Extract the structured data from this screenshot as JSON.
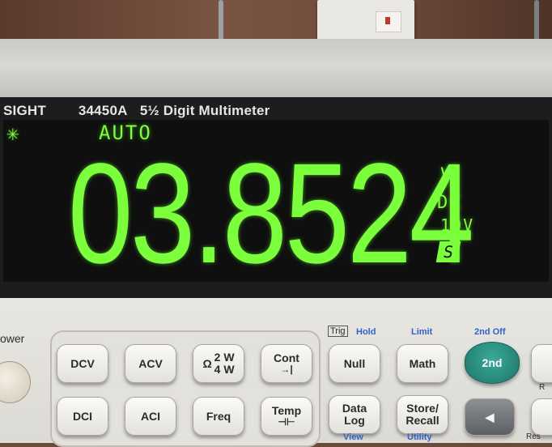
{
  "instrument": {
    "brand_fragment": "SIGHT",
    "model": "34450A",
    "description": "5½ Digit Multimeter"
  },
  "display": {
    "indicator": "✳",
    "auto": "AUTO",
    "reading": "03.8524",
    "unit": "V",
    "mode": "DC",
    "range": "10V",
    "badge": "S",
    "digit_color": "#7bff3c"
  },
  "panel": {
    "power_label": "ower",
    "trig_label": "Trig",
    "keys": {
      "dcv": "DCV",
      "acv": "ACV",
      "ohm_top": "2 W",
      "ohm_bottom": "4 W",
      "ohm_symbol": "Ω",
      "cont": "Cont",
      "cont_sub": "→|",
      "null": "Null",
      "math": "Math",
      "second": "2nd",
      "dci": "DCI",
      "aci": "ACI",
      "freq": "Freq",
      "temp": "Temp",
      "temp_sub": "⊣⊢",
      "data_log_1": "Data",
      "data_log_2": "Log",
      "store_1": "Store/",
      "store_2": "Recall",
      "left_arrow": "◀"
    },
    "shift_labels": {
      "hold": "Hold",
      "limit": "Limit",
      "second_off": "2nd Off",
      "view": "View",
      "utility": "Utility"
    },
    "right_edge": {
      "r": "R",
      "res": "Res"
    }
  }
}
